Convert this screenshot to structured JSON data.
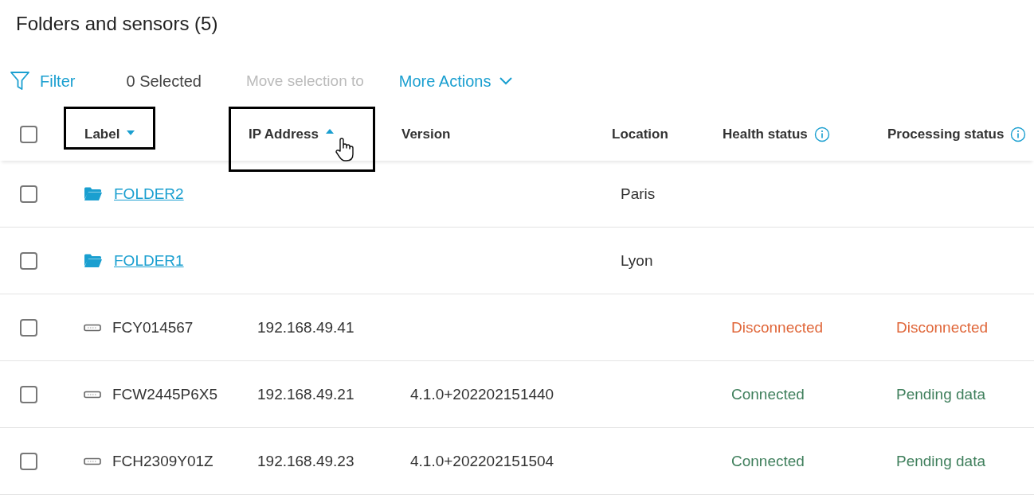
{
  "title": "Folders and sensors (5)",
  "toolbar": {
    "filter": "Filter",
    "selected_count": "0 Selected",
    "move": {
      "label": "Move selection to",
      "disabled": true
    },
    "more_actions": "More Actions"
  },
  "table": {
    "select_all": {
      "checked": false
    },
    "columns": [
      {
        "label": "Label",
        "sorted": true,
        "ascending": false,
        "framed": true,
        "info": false,
        "cursor": false
      },
      {
        "label": "IP Address",
        "sorted": true,
        "ascending": true,
        "framed": true,
        "info": false,
        "cursor": true
      },
      {
        "label": "Version",
        "sorted": false,
        "framed": false,
        "info": false,
        "cursor": false
      },
      {
        "label": "Location",
        "sorted": false,
        "framed": false,
        "info": false,
        "cursor": false
      },
      {
        "label": "Health status",
        "sorted": false,
        "framed": false,
        "info": true,
        "cursor": false
      },
      {
        "label": "Processing status",
        "sorted": false,
        "framed": false,
        "info": true,
        "cursor": false
      }
    ],
    "rows": [
      {
        "kind": "folder",
        "checked": false,
        "label": "FOLDER2",
        "location": "Paris"
      },
      {
        "kind": "folder",
        "checked": false,
        "label": "FOLDER1",
        "location": "Lyon"
      },
      {
        "kind": "sensor",
        "checked": false,
        "label": "FCY014567",
        "ip": "192.168.49.41",
        "health": {
          "text": "Disconnected",
          "color": "#e0673a"
        },
        "processing": {
          "text": "Disconnected",
          "color": "#e0673a"
        }
      },
      {
        "kind": "sensor",
        "checked": false,
        "label": "FCW2445P6X5",
        "ip": "192.168.49.21",
        "version": "4.1.0+202202151440",
        "health": {
          "text": "Connected",
          "color": "#3f7f5c"
        },
        "processing": {
          "text": "Pending data",
          "color": "#3f7f5c"
        }
      },
      {
        "kind": "sensor",
        "checked": false,
        "label": "FCH2309Y01Z",
        "ip": "192.168.49.23",
        "version": "4.1.0+202202151504",
        "health": {
          "text": "Connected",
          "color": "#3f7f5c"
        },
        "processing": {
          "text": "Pending data",
          "color": "#3f7f5c"
        }
      }
    ]
  }
}
